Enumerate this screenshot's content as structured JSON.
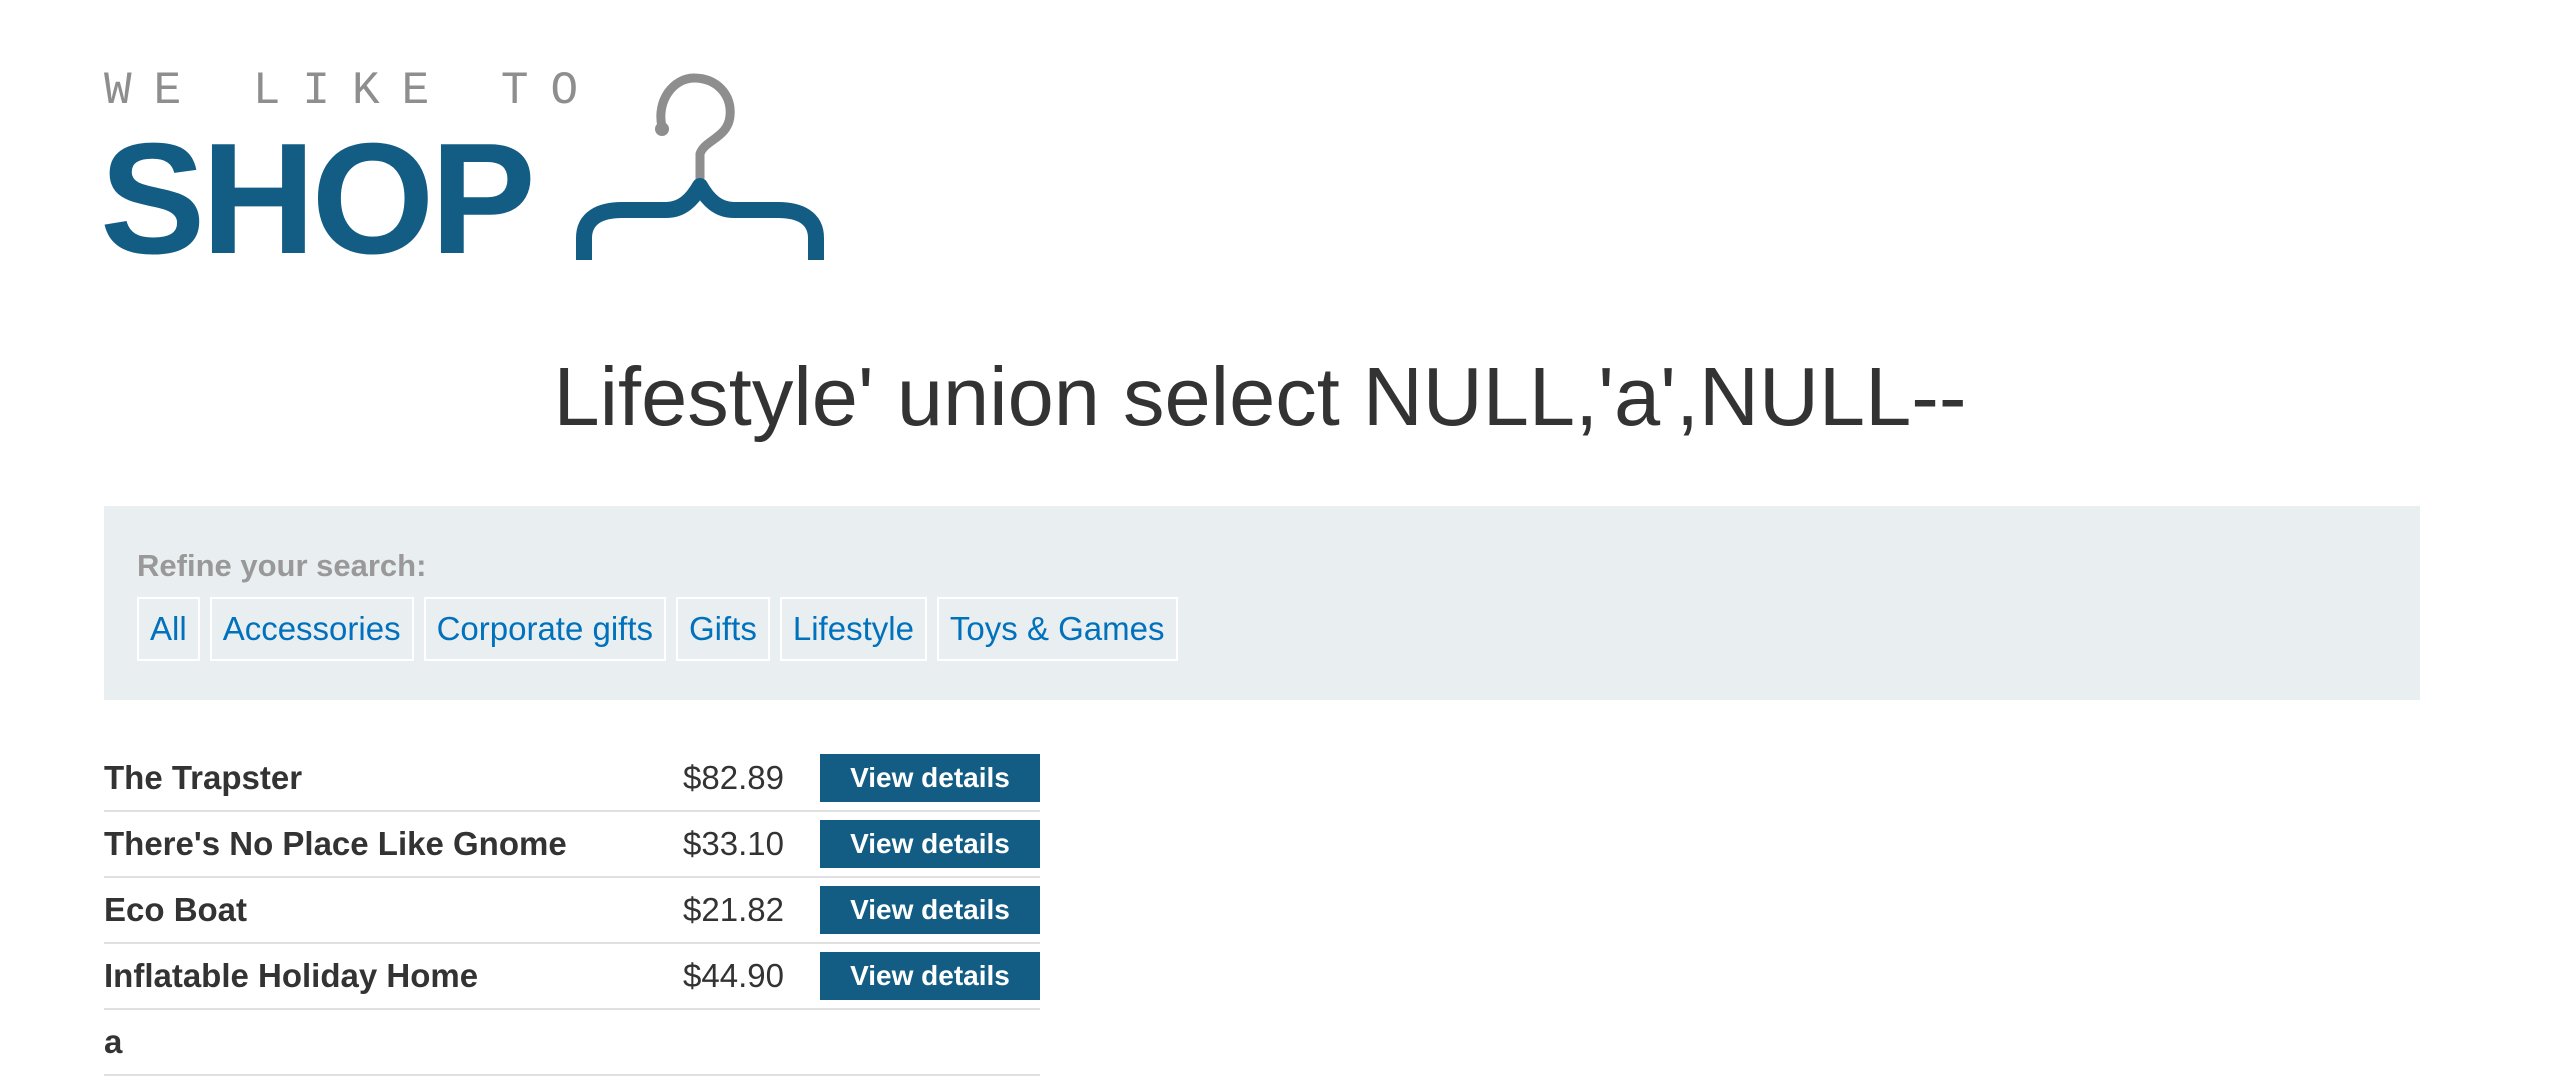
{
  "logo": {
    "tagline": "WE LIKE TO",
    "brand": "SHOP",
    "icon": "hanger-icon",
    "brand_color": "#135d84",
    "tagline_color": "#8e8e8e"
  },
  "page_title": "Lifestyle' union select NULL,'a',NULL--",
  "filters": {
    "label": "Refine your search:",
    "items": [
      {
        "label": "All"
      },
      {
        "label": "Accessories"
      },
      {
        "label": "Corporate gifts"
      },
      {
        "label": "Gifts"
      },
      {
        "label": "Lifestyle"
      },
      {
        "label": "Toys & Games"
      }
    ]
  },
  "products": [
    {
      "name": "The Trapster",
      "price": "$82.89",
      "action": "View details"
    },
    {
      "name": "There's No Place Like Gnome",
      "price": "$33.10",
      "action": "View details"
    },
    {
      "name": "Eco Boat",
      "price": "$21.82",
      "action": "View details"
    },
    {
      "name": "Inflatable Holiday Home",
      "price": "$44.90",
      "action": "View details"
    },
    {
      "name": "a",
      "price": "",
      "action": ""
    }
  ],
  "colors": {
    "accent": "#135d84",
    "link": "#0071bc",
    "filter_bg": "#e9eef1"
  }
}
